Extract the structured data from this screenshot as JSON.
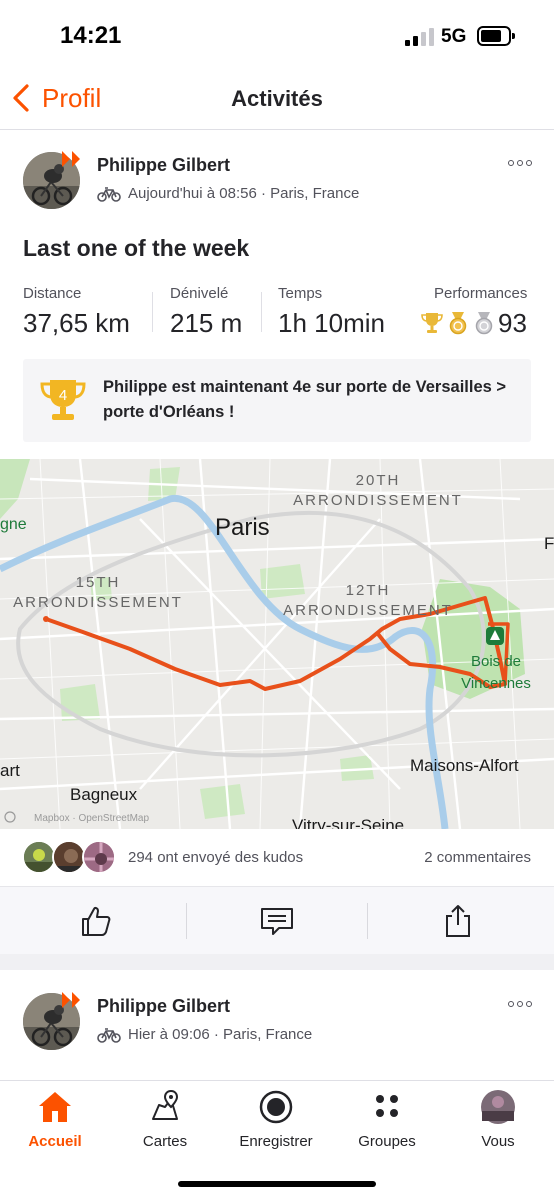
{
  "status_bar": {
    "time": "14:21",
    "network": "5G"
  },
  "nav": {
    "back_label": "Profil",
    "title": "Activités"
  },
  "activity": {
    "athlete": "Philippe Gilbert",
    "meta": "Aujourd'hui à 08:56 · Paris, France",
    "title": "Last one of the week",
    "stats": {
      "distance_label": "Distance",
      "distance_value": "37,65 km",
      "elevation_label": "Dénivelé",
      "elevation_value": "215 m",
      "time_label": "Temps",
      "time_value": "1h 10min",
      "performance_label": "Performances",
      "performance_value": "93"
    },
    "achievement": {
      "rank": "4",
      "text": "Philippe est maintenant 4e sur porte de Versailles > porte d'Orléans !"
    },
    "map_labels": {
      "paris": "Paris",
      "arr20_line1": "20TH",
      "arr20_line2": "ARRONDISSEMENT",
      "arr15_line1": "15TH",
      "arr15_line2": "ARRONDISSEMENT",
      "arr12_line1": "12TH",
      "arr12_line2": "ARRONDISSEMENT",
      "bois_line1": "Bois de",
      "bois_line2": "Vincennes",
      "bagneux": "Bagneux",
      "maisons_alfort": "Maisons-Alfort",
      "vitry": "Vitry-sur-Seine",
      "edge_left_top": "gne",
      "edge_left_bottom": "art",
      "edge_right": "F",
      "attribution": "Mapbox · OpenStreetMap"
    },
    "kudos_text": "294 ont envoyé des kudos",
    "comments_text": "2 commentaires"
  },
  "next_activity": {
    "athlete": "Philippe Gilbert",
    "meta": "Hier à 09:06 · Paris, France"
  },
  "tabs": [
    {
      "label": "Accueil",
      "icon": "home-icon",
      "active": true
    },
    {
      "label": "Cartes",
      "icon": "map-icon",
      "active": false
    },
    {
      "label": "Enregistrer",
      "icon": "record-icon",
      "active": false
    },
    {
      "label": "Groupes",
      "icon": "groups-icon",
      "active": false
    },
    {
      "label": "Vous",
      "icon": "profile-avatar",
      "active": false
    }
  ],
  "colors": {
    "accent": "#fc5200",
    "gold": "#f2c14e",
    "silver": "#b6b6bb",
    "route": "#e8501a",
    "park": "#bfe3b0",
    "water": "#a9cdea"
  }
}
